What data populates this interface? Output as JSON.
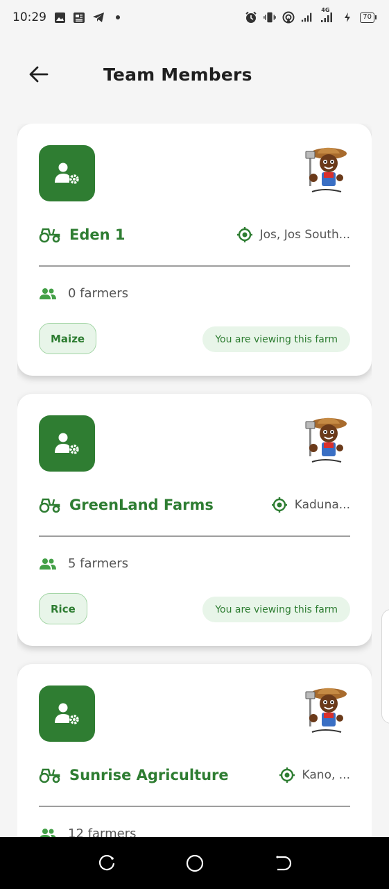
{
  "status_bar": {
    "time": "10:29",
    "left_icons": [
      "image-icon",
      "news-icon",
      "telegram-icon",
      "dot-icon"
    ],
    "right_icons": [
      "alarm-icon",
      "vibrate-icon",
      "hotspot-icon",
      "signal-icon",
      "signal-4g-icon",
      "charging-icon"
    ],
    "network_label": "4G",
    "battery_level": "70"
  },
  "header": {
    "back_icon": "arrow-left-icon",
    "title": "Team Members"
  },
  "colors": {
    "brand_green": "#2f7d32",
    "chip_bg": "#e8f5e9",
    "chip_border": "#a5d6a7",
    "background": "#f5f5f5"
  },
  "farms": [
    {
      "name": "Eden 1",
      "location": "Jos, Jos South...",
      "farmers": "0 farmers",
      "crop": "Maize",
      "status": "You are viewing this farm"
    },
    {
      "name": "GreenLand Farms",
      "location": "Kaduna...",
      "farmers": "5 farmers",
      "crop": "Rice",
      "status": "You are viewing this farm"
    },
    {
      "name": "Sunrise Agriculture",
      "location": "Kano, ...",
      "farmers": "12 farmers",
      "crop": "",
      "status": ""
    }
  ],
  "nav_bar": {
    "icons": [
      "recent-apps-icon",
      "home-icon",
      "back-icon"
    ]
  }
}
